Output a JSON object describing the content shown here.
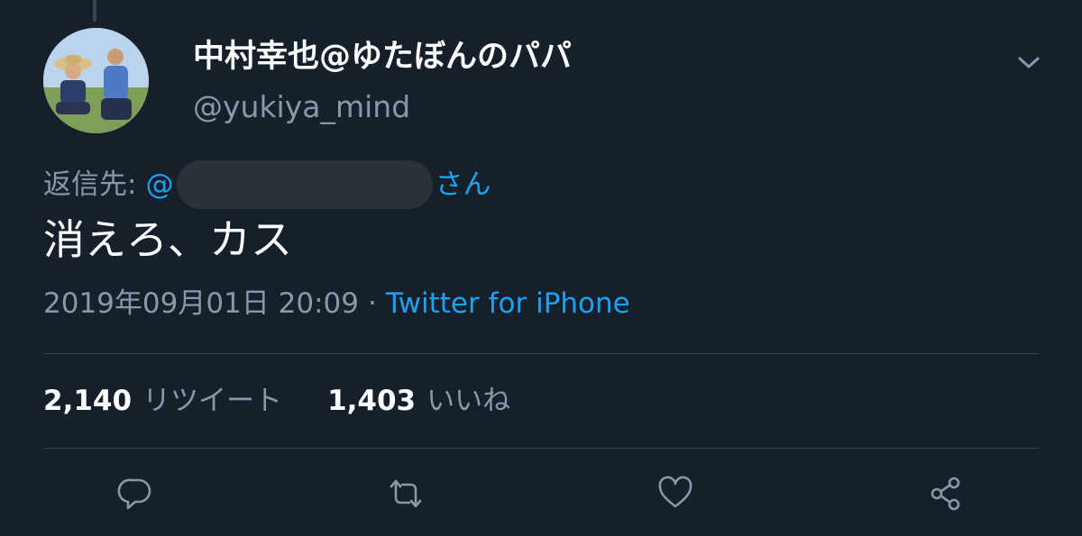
{
  "tweet": {
    "display_name": "中村幸也@ゆたぼんのパパ",
    "handle": "@yukiya_mind",
    "reply_to_prefix": "返信先:",
    "reply_to_at": "@",
    "reply_to_suffix": "さん",
    "text": "消えろ、カス",
    "timestamp": "2019年09月01日 20:09",
    "separator": "·",
    "source": "Twitter for iPhone"
  },
  "stats": {
    "retweets_count": "2,140",
    "retweets_label": "リツイート",
    "likes_count": "1,403",
    "likes_label": "いいね"
  },
  "icons": {
    "menu": "chevron-down-icon",
    "reply": "reply-icon",
    "retweet": "retweet-icon",
    "like": "heart-icon",
    "share": "share-icon"
  },
  "colors": {
    "background": "#15202b",
    "text": "#ffffff",
    "secondary_text": "#8899a6",
    "accent": "#1da1f2",
    "divider": "#38444d"
  }
}
